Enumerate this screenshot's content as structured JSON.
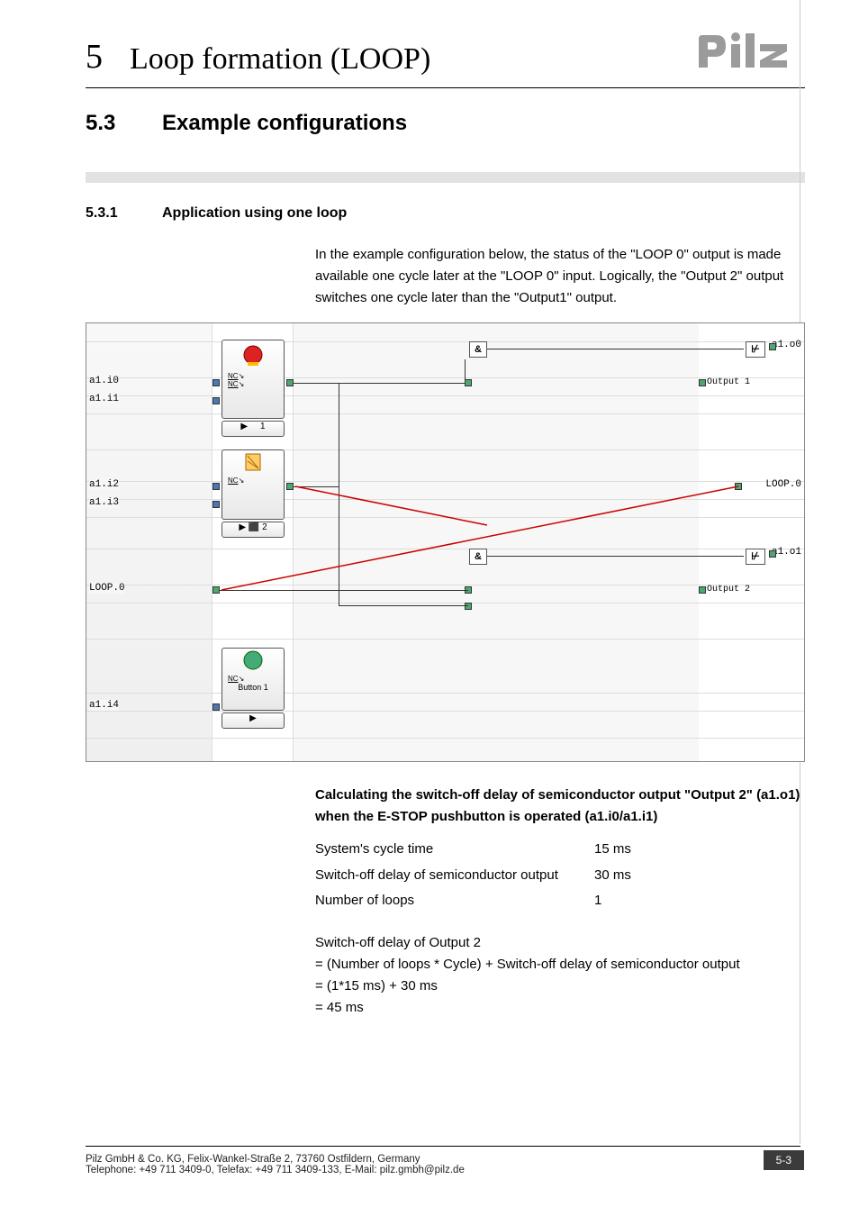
{
  "chapter": {
    "num": "5",
    "title": "Loop formation (LOOP)"
  },
  "h1": {
    "num": "5.3",
    "title": "Example configurations"
  },
  "h2": {
    "num": "5.3.1",
    "title": "Application using one loop"
  },
  "intro": "In the example configuration below, the status of the \"LOOP 0\" output is made available one cycle later at the \"LOOP 0\" input. Logically, the \"Output 2\" output switches one cycle later than the \"Output1\" output.",
  "diagram": {
    "inputs": [
      "a1.i0",
      "a1.i1",
      "a1.i2",
      "a1.i3",
      "LOOP.0",
      "a1.i4"
    ],
    "outputs_right": [
      "a1.o0",
      "LOOP.0",
      "a1.o1"
    ],
    "output_names": [
      "Output 1",
      "Output 2"
    ],
    "button_label": "Button 1",
    "nc": "NC",
    "and": "&",
    "block_ids": [
      "1",
      "2"
    ]
  },
  "calc_heading": "Calculating the switch-off delay of semiconductor output \"Output 2\" (a1.o1) when the E-STOP pushbutton is operated (a1.i0/a1.i1)",
  "calc_rows": [
    {
      "label": "System's cycle time",
      "value": "15 ms"
    },
    {
      "label": "Switch-off delay of semiconductor output",
      "value": "30 ms"
    },
    {
      "label": "Number of loops",
      "value": "1"
    }
  ],
  "calc_lines": [
    "Switch-off delay of Output 2",
    "= (Number of loops * Cycle) + Switch-off delay of semiconductor output",
    "= (1*15 ms) + 30 ms",
    "= 45 ms"
  ],
  "footer": {
    "line1": "Pilz GmbH & Co. KG, Felix-Wankel-Straße 2, 73760 Ostfildern, Germany",
    "line2": "Telephone: +49 711 3409-0, Telefax: +49 711 3409-133, E-Mail: pilz.gmbh@pilz.de",
    "page": "5-3"
  }
}
